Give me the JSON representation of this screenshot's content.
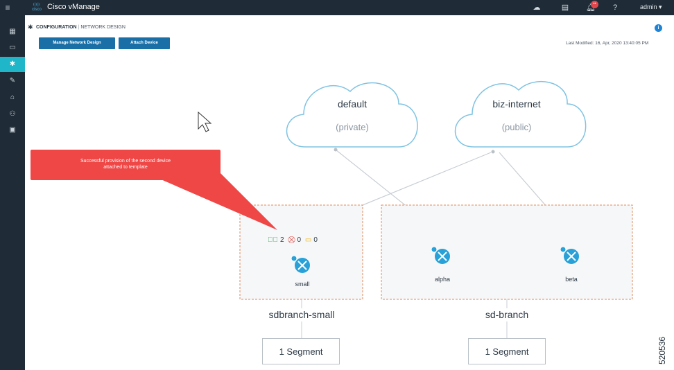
{
  "header": {
    "app_title": "Cisco vManage",
    "logo_text": "cisco",
    "user": "admin ▾",
    "notification_count": "••"
  },
  "icons": {
    "menu": "hamburger-icon",
    "cloud": "cloud-icon",
    "tasks": "clipboard-icon",
    "alarms": "bell-icon",
    "help": "help-icon"
  },
  "sidebar": {
    "items": [
      {
        "name": "dashboard-icon",
        "glyph": "▦"
      },
      {
        "name": "monitor-icon",
        "glyph": "▭"
      },
      {
        "name": "configuration-icon",
        "glyph": "✱"
      },
      {
        "name": "tools-icon",
        "glyph": "✎"
      },
      {
        "name": "maintenance-icon",
        "glyph": "⌂"
      },
      {
        "name": "administration-icon",
        "glyph": "⚇"
      },
      {
        "name": "analytics-icon",
        "glyph": "▣"
      }
    ],
    "active_index": 2
  },
  "breadcrumb": {
    "section": "CONFIGURATION",
    "separator": "|",
    "page": "NETWORK DESIGN"
  },
  "toolbar": {
    "manage_label": "Manage Network Design",
    "attach_label": "Attach Device",
    "last_modified": "Last Modified: 16, Apr, 2020 13:40:05 PM"
  },
  "clouds": [
    {
      "name": "default",
      "type": "(private)"
    },
    {
      "name": "biz-internet",
      "type": "(public)"
    }
  ],
  "callout": {
    "line1": "Successful provision of the second device",
    "line2": "attached to template"
  },
  "counters": {
    "success": "2",
    "failed": "0",
    "pending": "0"
  },
  "sites": [
    {
      "name": "sdbranch-small",
      "devices": [
        "small"
      ],
      "segment": "1 Segment"
    },
    {
      "name": "sd-branch",
      "devices": [
        "alpha",
        "beta"
      ],
      "segment": "1 Segment"
    }
  ],
  "colors": {
    "topbar": "#1f2b36",
    "accent": "#1fb6c9",
    "button": "#1a6fa6",
    "callout": "#ef4646",
    "device": "#27a1d8",
    "site_border": "#e08a5a",
    "cloud_stroke": "#7fc3e2"
  },
  "figure_id": "520536"
}
